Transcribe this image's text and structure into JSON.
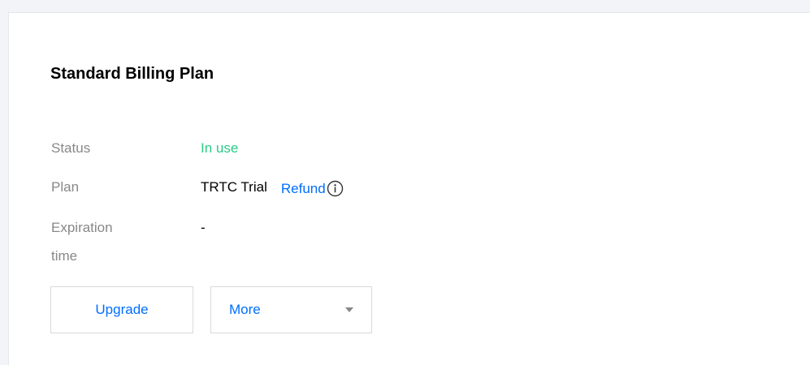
{
  "card": {
    "title": "Standard Billing Plan"
  },
  "status": {
    "label": "Status",
    "value": "In use",
    "value_color": "#29cc85"
  },
  "plan": {
    "label": "Plan",
    "value": "TRTC Trial",
    "refund_label": "Refund",
    "refund_icon": "info-icon"
  },
  "expiration": {
    "label_line1": "Expiration",
    "label_line2": "time",
    "value": "-"
  },
  "actions": {
    "upgrade_label": "Upgrade",
    "more_label": "More",
    "more_icon": "caret-down-icon"
  },
  "colors": {
    "link": "#006eff",
    "label": "#888888",
    "background": "#f3f4f7"
  }
}
